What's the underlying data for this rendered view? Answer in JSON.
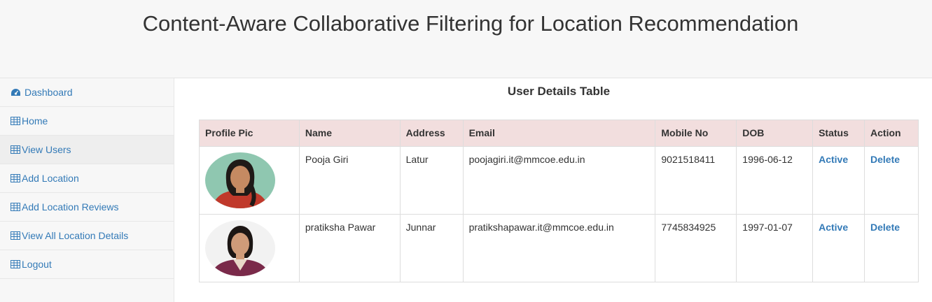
{
  "header": {
    "title": "Content-Aware Collaborative Filtering for Location Recommendation"
  },
  "sidebar": {
    "items": [
      {
        "label": "Dashboard",
        "icon": "dashboard-icon"
      },
      {
        "label": "Home",
        "icon": "table-icon"
      },
      {
        "label": "View Users",
        "icon": "table-icon",
        "active": true
      },
      {
        "label": "Add Location",
        "icon": "table-icon"
      },
      {
        "label": "Add Location Reviews",
        "icon": "table-icon"
      },
      {
        "label": "View All Location Details",
        "icon": "table-icon"
      },
      {
        "label": "Logout",
        "icon": "table-icon"
      }
    ]
  },
  "main": {
    "title": "User Details Table",
    "table": {
      "columns": [
        "Profile Pic",
        "Name",
        "Address",
        "Email",
        "Mobile No",
        "DOB",
        "Status",
        "Action"
      ],
      "rows": [
        {
          "name": "Pooja Giri",
          "address": "Latur",
          "email": "poojagiri.it@mmcoe.edu.in",
          "mobile": "9021518411",
          "dob": "1996-06-12",
          "status": "Active",
          "action": "Delete"
        },
        {
          "name": "pratiksha Pawar",
          "address": "Junnar",
          "email": "pratikshapawar.it@mmcoe.edu.in",
          "mobile": "7745834925",
          "dob": "1997-01-07",
          "status": "Active",
          "action": "Delete"
        }
      ]
    }
  },
  "colors": {
    "link": "#337ab7",
    "header_row": "#f2dede",
    "sidebar_bg": "#f7f7f7"
  }
}
